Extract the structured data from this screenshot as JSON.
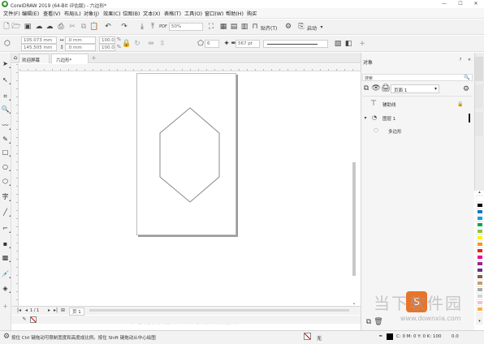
{
  "titlebar": {
    "title": "CorelDRAW 2019 (64-Bit 评估版) - 六边形*",
    "min": "—",
    "max": "☐",
    "close": "✕"
  },
  "menu": {
    "items": [
      "文件(F)",
      "编辑(E)",
      "查看(V)",
      "布局(L)",
      "对象(J)",
      "效果(C)",
      "位图(B)",
      "文本(X)",
      "表格(T)",
      "工具(O)",
      "窗口(W)",
      "帮助(H)",
      "购买"
    ]
  },
  "toolbar": {
    "zoom_value": "50%",
    "snap_label": "贴齐(T)",
    "launch_label": "启动"
  },
  "propbar": {
    "x": "105.073 mm",
    "y": "145.505 mm",
    "w": ".0 mm",
    "h": ".0 mm",
    "sx": "100.0",
    "sy": "100.0",
    "unit": "%",
    "sides": "6",
    "outline_width": "567 pt"
  },
  "tabs": {
    "welcome": "欢迎屏幕",
    "document": "六边形*"
  },
  "objects_panel": {
    "title": "对象",
    "search_placeholder": "搜索",
    "page_select": "页面 1",
    "rows": [
      "辅助线",
      "图层 1",
      "多边形"
    ]
  },
  "page_nav": {
    "label": "页 1",
    "pos": "1 / 1"
  },
  "canvas_hint": "再单击可拖动倾斜或旋转。以相同中心点或对齐方式缩放对象…",
  "status": {
    "left": "按住 Ctrl 键拖动可限制宽度和高度成比例。按住 Shift 键拖动从中心绘图",
    "fill": "无",
    "cmyk": "C: 0 M: 0 Y: 0 K: 100",
    "outline_w": "0.0"
  },
  "watermark": "当下软件园",
  "watermark_url": "www.downxia.com",
  "colors": {
    "chrome": "#f2f2f2",
    "chrome_dark": "#e6e6e6",
    "border": "#cfcfcf",
    "workspace": "#ffffff",
    "page_shadow": "#9a9a9a",
    "hexagon": "#8a8a8a",
    "scroll_thumb": "#c8c8c8",
    "accent_blue": "#2e6fb5",
    "watermark_orange": "#e8742a"
  },
  "palette": [
    "#ffffff",
    "#000000",
    "#1a75bb",
    "#00a0e9",
    "#00a651",
    "#8dc63f",
    "#fff200",
    "#f7941d",
    "#ed1c24",
    "#ec008c",
    "#92278f",
    "#662d91",
    "#8b5e3c",
    "#c69c6d",
    "#a7a9ac",
    "#d1d3d4",
    "#f4c2c2",
    "#fbb03b"
  ]
}
